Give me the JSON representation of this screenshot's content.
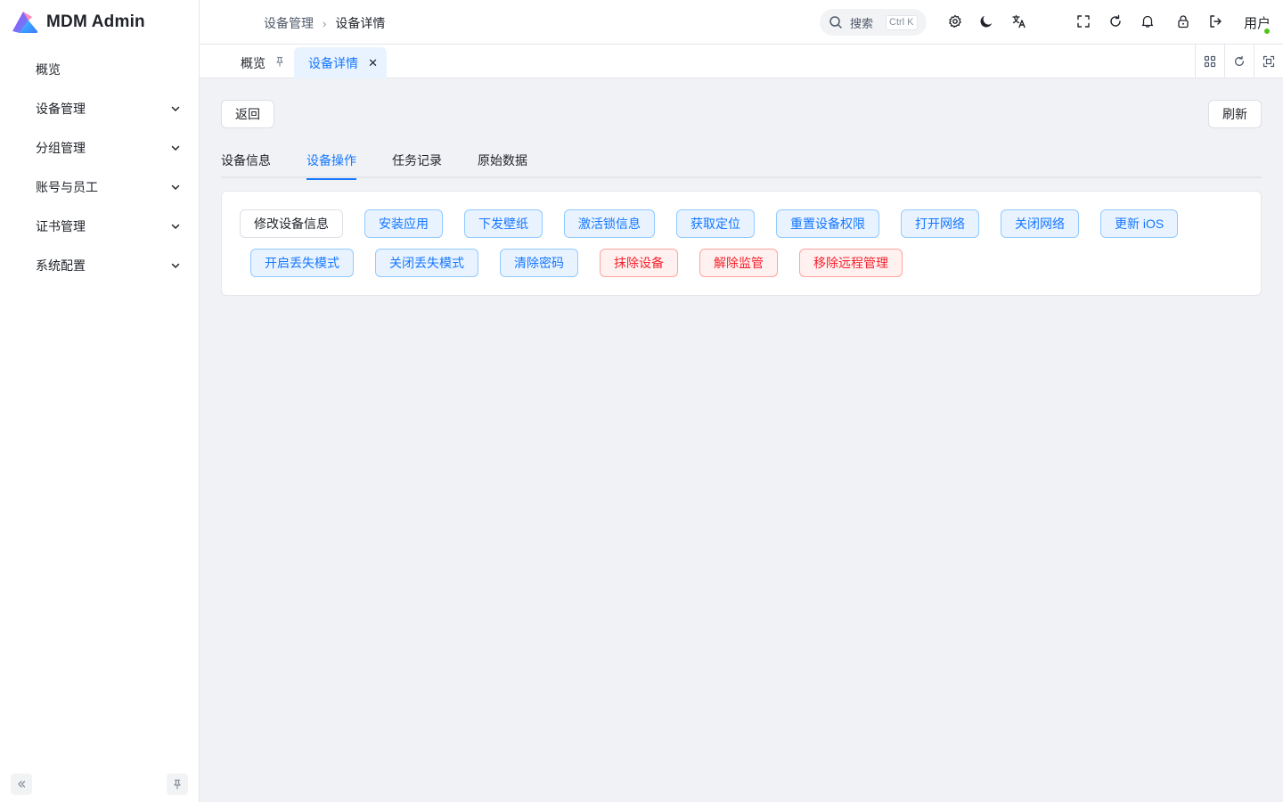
{
  "app": {
    "title": "MDM Admin"
  },
  "sidebar": {
    "items": [
      {
        "label": "概览",
        "expandable": false
      },
      {
        "label": "设备管理",
        "expandable": true
      },
      {
        "label": "分组管理",
        "expandable": true
      },
      {
        "label": "账号与员工",
        "expandable": true
      },
      {
        "label": "证书管理",
        "expandable": true
      },
      {
        "label": "系统配置",
        "expandable": true
      }
    ]
  },
  "header": {
    "breadcrumb": [
      "设备管理",
      "设备详情"
    ],
    "search": {
      "placeholder": "搜索",
      "shortcut": "Ctrl K"
    },
    "user": "用户",
    "icons": [
      "gear-icon",
      "moon-icon",
      "translate-icon",
      "fullscreen-icon",
      "refresh-icon",
      "bell-icon",
      "lock-icon",
      "logout-icon"
    ]
  },
  "tabs": [
    {
      "label": "概览",
      "active": false,
      "icon": "pin-icon"
    },
    {
      "label": "设备详情",
      "active": true,
      "icon": "close-icon"
    }
  ],
  "toolbar": {
    "back_label": "返回",
    "refresh_label": "刷新"
  },
  "subtabs": [
    {
      "label": "设备信息",
      "active": false
    },
    {
      "label": "设备操作",
      "active": true
    },
    {
      "label": "任务记录",
      "active": false
    },
    {
      "label": "原始数据",
      "active": false
    }
  ],
  "actions": [
    {
      "label": "修改设备信息",
      "type": "default"
    },
    {
      "label": "安装应用",
      "type": "primary"
    },
    {
      "label": "下发壁纸",
      "type": "primary"
    },
    {
      "label": "激活锁信息",
      "type": "primary"
    },
    {
      "label": "获取定位",
      "type": "primary"
    },
    {
      "label": "重置设备权限",
      "type": "primary"
    },
    {
      "label": "打开网络",
      "type": "primary"
    },
    {
      "label": "关闭网络",
      "type": "primary"
    },
    {
      "label": "更新 iOS",
      "type": "primary"
    },
    {
      "label": "开启丢失模式",
      "type": "primary"
    },
    {
      "label": "关闭丢失模式",
      "type": "primary"
    },
    {
      "label": "清除密码",
      "type": "primary"
    },
    {
      "label": "抹除设备",
      "type": "danger"
    },
    {
      "label": "解除监管",
      "type": "danger"
    },
    {
      "label": "移除远程管理",
      "type": "danger"
    }
  ],
  "colors": {
    "accent": "#1677ff",
    "danger": "#f5222d",
    "content_bg": "#f1f2f5"
  }
}
